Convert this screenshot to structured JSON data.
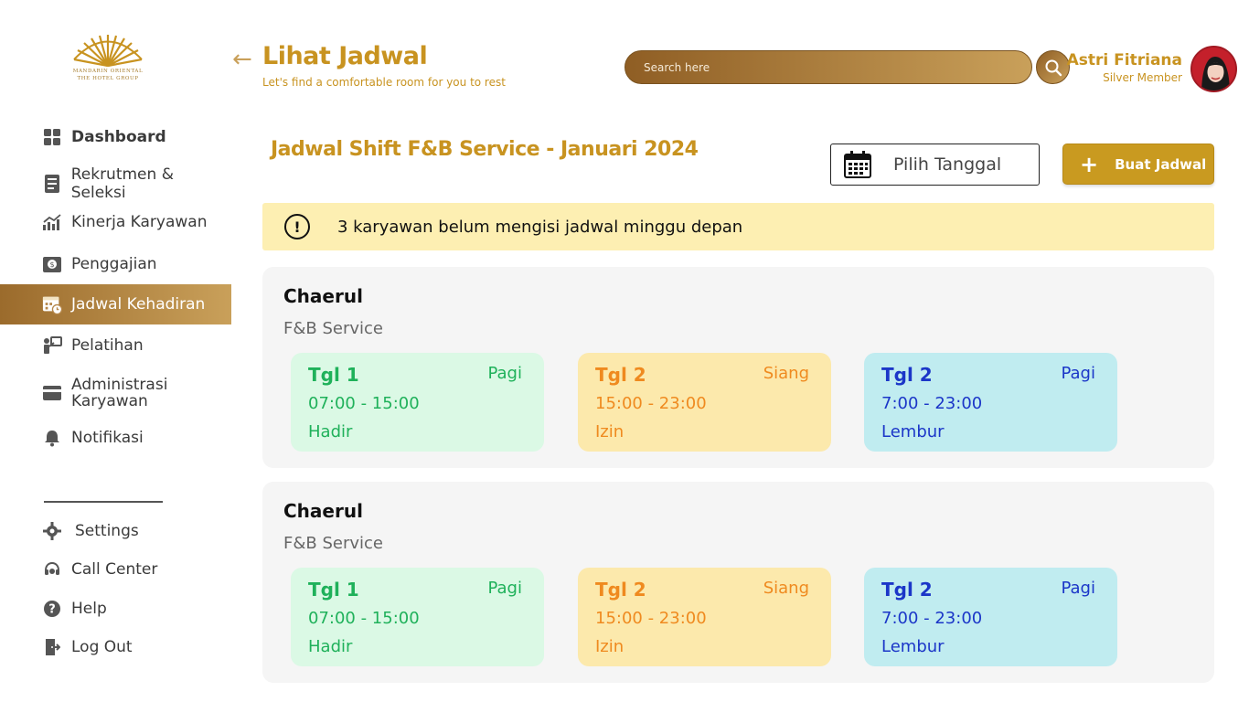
{
  "logo": {
    "line1": "MANDARIN ORIENTAL",
    "line2": "THE HOTEL GROUP"
  },
  "sidebar": {
    "items": [
      {
        "label": "Dashboard",
        "icon": "grid-icon"
      },
      {
        "label": "Rekrutmen & Seleksi",
        "icon": "document-icon"
      },
      {
        "label": "Kinerja Karyawan",
        "icon": "chart-icon"
      },
      {
        "label": "Penggajian",
        "icon": "payroll-icon"
      },
      {
        "label": "Jadwal Kehadiran",
        "icon": "calendar-clock-icon"
      },
      {
        "label": "Pelatihan",
        "icon": "training-icon"
      },
      {
        "label": "Administrasi Karyawan",
        "icon": "card-icon"
      },
      {
        "label": "Notifikasi",
        "icon": "bell-icon"
      }
    ],
    "bottom": [
      {
        "label": "Settings",
        "icon": "gear-icon"
      },
      {
        "label": "Call Center",
        "icon": "headset-icon"
      },
      {
        "label": "Help",
        "icon": "help-icon"
      },
      {
        "label": "Log Out",
        "icon": "logout-icon"
      }
    ]
  },
  "header": {
    "title": "Lihat Jadwal",
    "subtitle": "Let's find a comfortable room for you to rest",
    "search_placeholder": "Search here",
    "user_name": "Astri Fitriana",
    "user_role": "Silver Member"
  },
  "main": {
    "section_title": "Jadwal Shift F&B Service - Januari 2024",
    "date_picker_label": "Pilih Tanggal",
    "create_button_label": "Buat Jadwal",
    "alert_text": "3 karyawan belum mengisi jadwal minggu depan",
    "employees": [
      {
        "name": "Chaerul",
        "department": "F&B Service",
        "shifts": [
          {
            "date": "Tgl 1",
            "type": "Pagi",
            "time": "07:00 - 15:00",
            "status": "Hadir"
          },
          {
            "date": "Tgl 2",
            "type": "Siang",
            "time": "15:00 - 23:00",
            "status": "Izin"
          },
          {
            "date": "Tgl 2",
            "type": "Pagi",
            "time": "7:00 - 23:00",
            "status": "Lembur"
          }
        ]
      },
      {
        "name": "Chaerul",
        "department": "F&B Service",
        "shifts": [
          {
            "date": "Tgl 1",
            "type": "Pagi",
            "time": "07:00 - 15:00",
            "status": "Hadir"
          },
          {
            "date": "Tgl 2",
            "type": "Siang",
            "time": "15:00 - 23:00",
            "status": "Izin"
          },
          {
            "date": "Tgl 2",
            "type": "Pagi",
            "time": "7:00 - 23:00",
            "status": "Lembur"
          }
        ]
      }
    ]
  },
  "colors": {
    "brand_gold": "#c89320",
    "active_gradient_start": "#9b6b2c",
    "active_gradient_end": "#c9a05a",
    "alert_bg": "#fdefb2",
    "status_hadir": "#1fb15a",
    "status_izin": "#ef8a1f",
    "status_lembur": "#1b36c8"
  }
}
